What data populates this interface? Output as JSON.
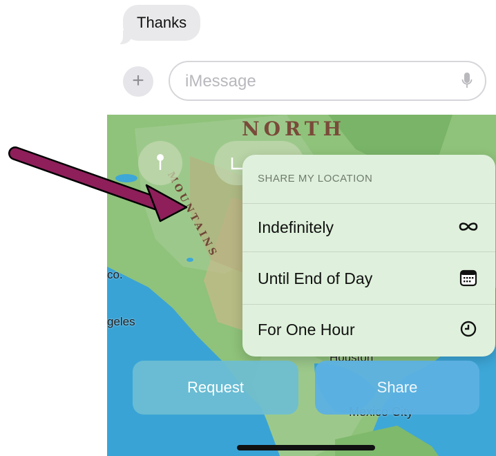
{
  "messages": {
    "received_text": "Thanks"
  },
  "compose": {
    "plus_label": "+",
    "placeholder": "iMessage",
    "value": ""
  },
  "map": {
    "region_label": "NORTH",
    "mountains_label": "MOUNTAINS",
    "places": [
      "co.",
      "geles",
      "Houston",
      "Mexico City"
    ]
  },
  "share_menu": {
    "header": "SHARE MY LOCATION",
    "items": [
      {
        "label": "Indefinitely",
        "icon": "infinity-icon"
      },
      {
        "label": "Until End of Day",
        "icon": "calendar-icon"
      },
      {
        "label": "For One Hour",
        "icon": "clock-icon"
      }
    ]
  },
  "actions": {
    "request_label": "Request",
    "share_label": "Share"
  },
  "colors": {
    "annotation_arrow": "#8e1f5a",
    "menu_bg": "#dff1dc",
    "share_button": "#5cb1e2"
  }
}
